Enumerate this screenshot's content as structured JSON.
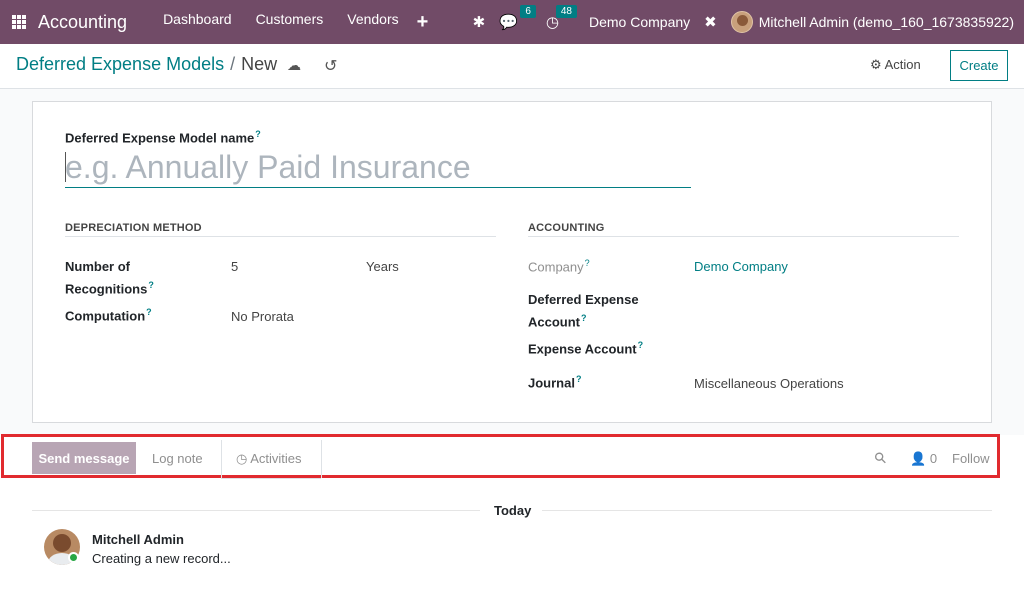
{
  "navbar": {
    "brand": "Accounting",
    "menu": [
      "Dashboard",
      "Customers",
      "Vendors"
    ],
    "plus": "+",
    "messages_count": "6",
    "activities_count": "48",
    "company": "Demo Company",
    "user": "Mitchell Admin (demo_160_1673835922)"
  },
  "control": {
    "breadcrumb_parent": "Deferred Expense Models",
    "breadcrumb_sep": "/",
    "breadcrumb_current": "New",
    "action_label": "Action",
    "create_label": "Create"
  },
  "form": {
    "name_label": "Deferred Expense Model name",
    "name_placeholder": "e.g. Annually Paid Insurance",
    "help_mark": "?",
    "depreciation": {
      "title": "DEPRECIATION METHOD",
      "recognitions_label_1": "Number of",
      "recognitions_label_2": "Recognitions",
      "recognitions_value": "5",
      "recognitions_unit": "Years",
      "computation_label": "Computation",
      "computation_value": "No Prorata"
    },
    "accounting": {
      "title": "ACCOUNTING",
      "company_label": "Company",
      "company_value": "Demo Company",
      "deferred_label_1": "Deferred Expense",
      "deferred_label_2": "Account",
      "expense_label": "Expense Account",
      "journal_label": "Journal",
      "journal_value": "Miscellaneous Operations"
    }
  },
  "chatter": {
    "send_message": "Send message",
    "log_note": "Log note",
    "activities": "Activities",
    "followers_count": "0",
    "follow": "Follow",
    "today": "Today",
    "author": "Mitchell Admin",
    "message": "Creating a new record..."
  },
  "colors": {
    "navbar": "#714b67",
    "accent": "#017e84",
    "highlight_box": "#e12a2f",
    "send_button": "#b8a5b4"
  }
}
